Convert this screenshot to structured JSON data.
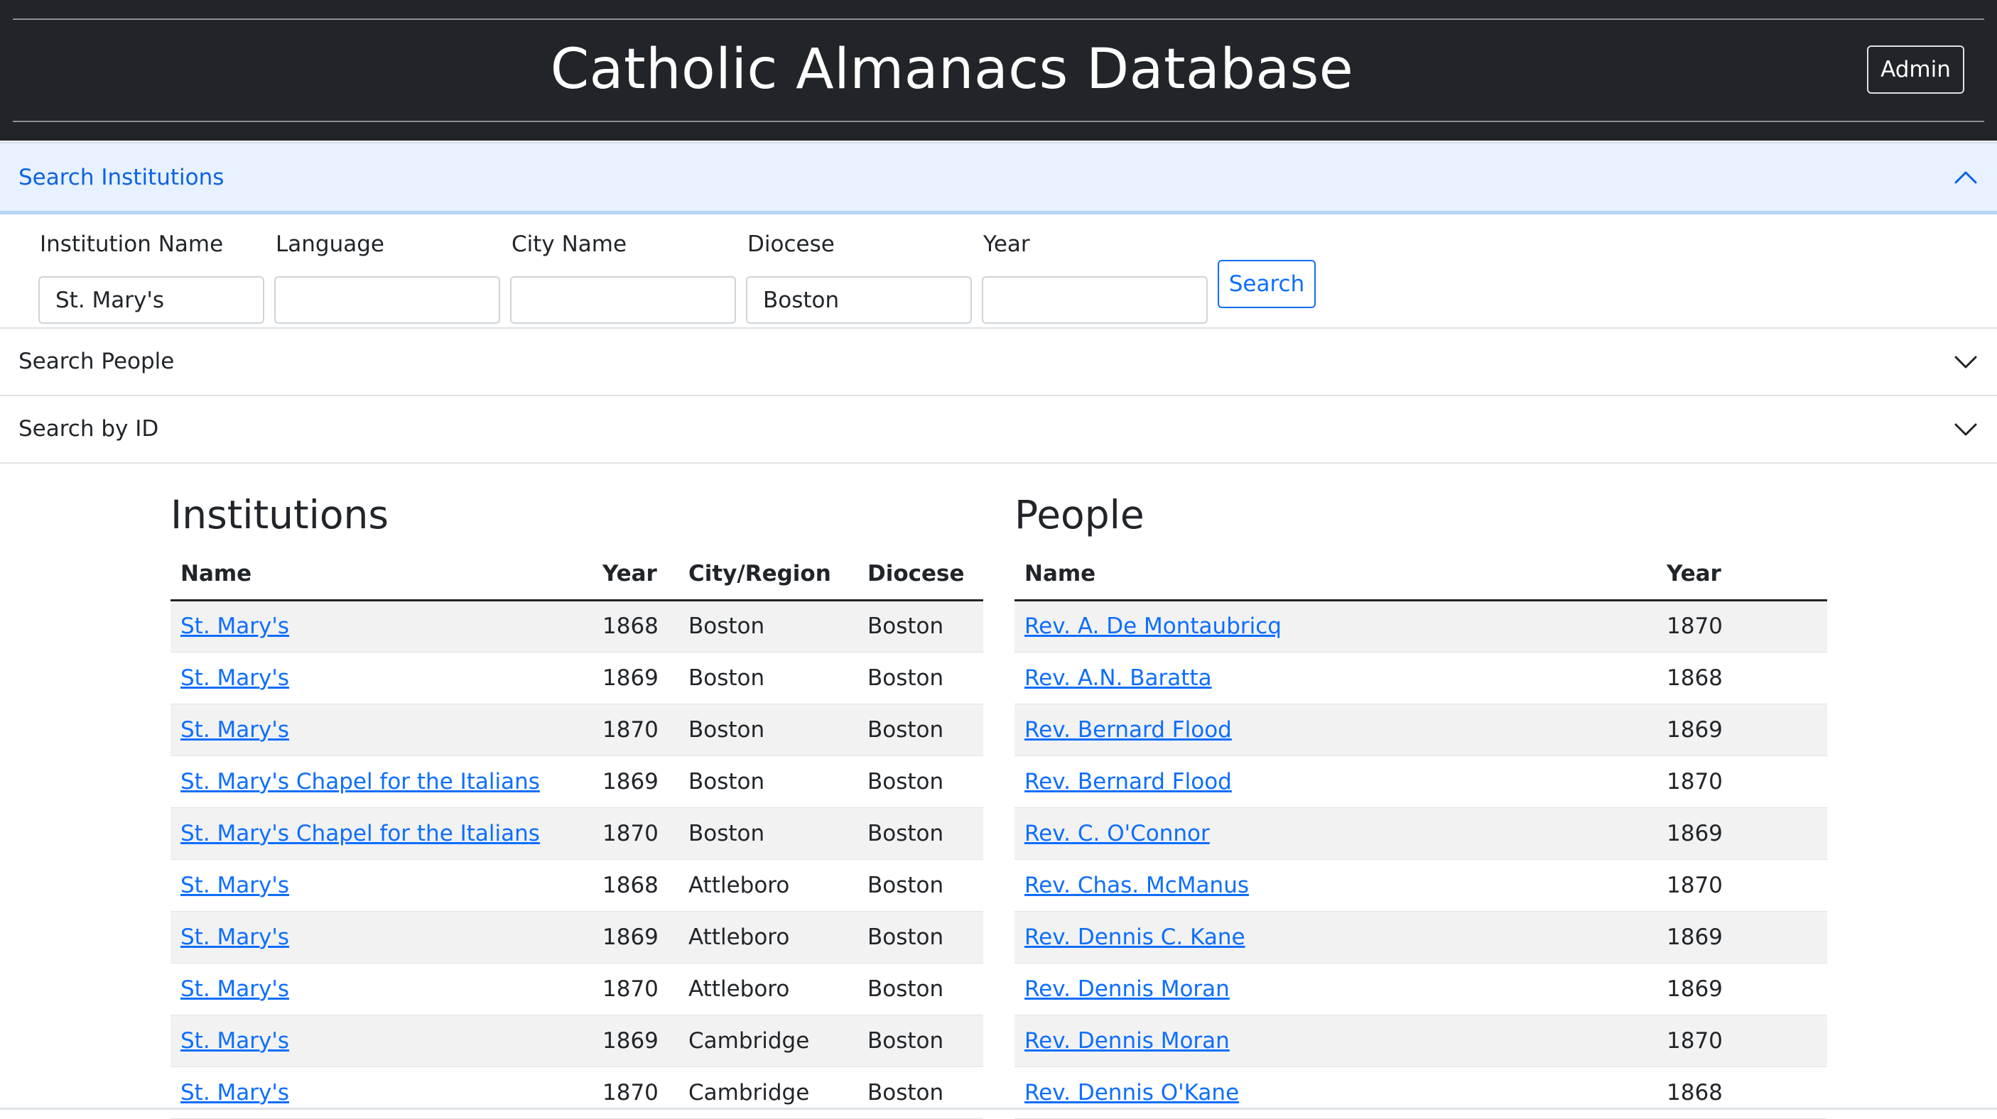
{
  "header": {
    "title": "Catholic Almanacs Database",
    "admin_label": "Admin"
  },
  "accordion": {
    "institutions": {
      "label": "Search Institutions",
      "expanded": true,
      "fields": [
        {
          "label": "Institution Name",
          "value": "St. Mary's"
        },
        {
          "label": "Language",
          "value": ""
        },
        {
          "label": "City Name",
          "value": ""
        },
        {
          "label": "Diocese",
          "value": "Boston"
        },
        {
          "label": "Year",
          "value": ""
        }
      ],
      "search_label": "Search"
    },
    "people": {
      "label": "Search People",
      "expanded": false
    },
    "by_id": {
      "label": "Search by ID",
      "expanded": false
    }
  },
  "institutions": {
    "title": "Institutions",
    "columns": [
      "Name",
      "Year",
      "City/Region",
      "Diocese"
    ],
    "rows": [
      {
        "name": "St. Mary's",
        "year": "1868",
        "city": "Boston",
        "diocese": "Boston"
      },
      {
        "name": "St. Mary's",
        "year": "1869",
        "city": "Boston",
        "diocese": "Boston"
      },
      {
        "name": "St. Mary's",
        "year": "1870",
        "city": "Boston",
        "diocese": "Boston"
      },
      {
        "name": "St. Mary's Chapel for the Italians",
        "year": "1869",
        "city": "Boston",
        "diocese": "Boston"
      },
      {
        "name": "St. Mary's Chapel for the Italians",
        "year": "1870",
        "city": "Boston",
        "diocese": "Boston"
      },
      {
        "name": "St. Mary's",
        "year": "1868",
        "city": "Attleboro",
        "diocese": "Boston"
      },
      {
        "name": "St. Mary's",
        "year": "1869",
        "city": "Attleboro",
        "diocese": "Boston"
      },
      {
        "name": "St. Mary's",
        "year": "1870",
        "city": "Attleboro",
        "diocese": "Boston"
      },
      {
        "name": "St. Mary's",
        "year": "1869",
        "city": "Cambridge",
        "diocese": "Boston"
      },
      {
        "name": "St. Mary's",
        "year": "1870",
        "city": "Cambridge",
        "diocese": "Boston"
      }
    ]
  },
  "people": {
    "title": "People",
    "columns": [
      "Name",
      "Year"
    ],
    "rows": [
      {
        "name": "Rev. A. De Montaubricq",
        "year": "1870"
      },
      {
        "name": "Rev. A.N. Baratta",
        "year": "1868"
      },
      {
        "name": "Rev. Bernard Flood",
        "year": "1869"
      },
      {
        "name": "Rev. Bernard Flood",
        "year": "1870"
      },
      {
        "name": "Rev. C. O'Connor",
        "year": "1869"
      },
      {
        "name": "Rev. Chas. McManus",
        "year": "1870"
      },
      {
        "name": "Rev. Dennis C. Kane",
        "year": "1869"
      },
      {
        "name": "Rev. Dennis Moran",
        "year": "1869"
      },
      {
        "name": "Rev. Dennis Moran",
        "year": "1870"
      },
      {
        "name": "Rev. Dennis O'Kane",
        "year": "1868"
      }
    ]
  }
}
